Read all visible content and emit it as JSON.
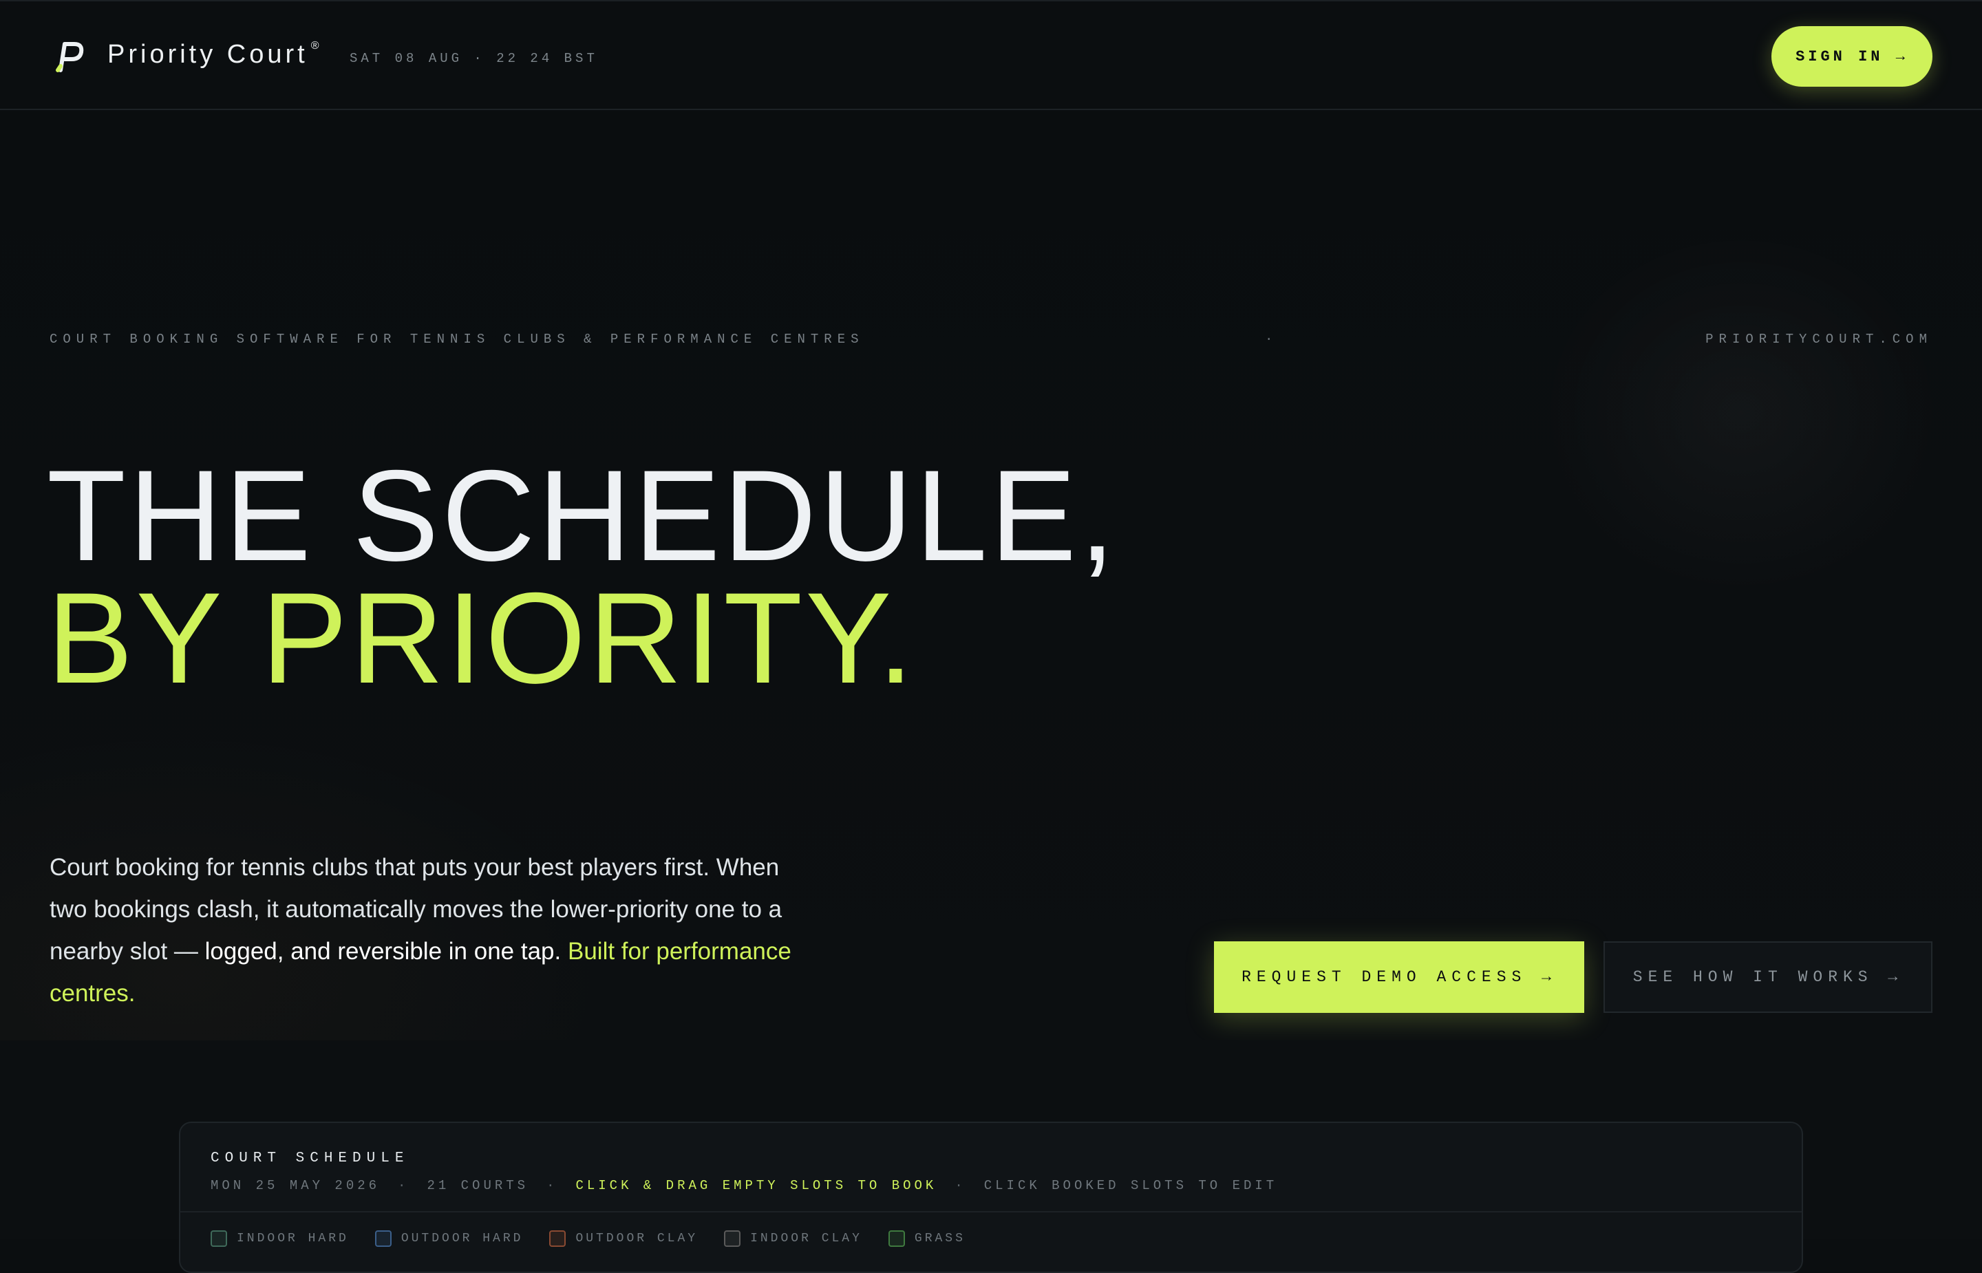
{
  "header": {
    "brand": "Priority Court",
    "brand_mark": "®",
    "datetime": "SAT 08 AUG · 22 24 BST",
    "signin_label": "SIGN IN →"
  },
  "hero": {
    "eyebrow_left": "COURT BOOKING SOFTWARE FOR TENNIS CLUBS & PERFORMANCE CENTRES",
    "eyebrow_dot": "·",
    "eyebrow_right": "PRIORITYCOURT.COM",
    "headline_line1": "THE SCHEDULE,",
    "headline_line2": "BY PRIORITY.",
    "lede_part1": "Court booking for tennis clubs that puts your best players first. When two bookings clash, it automatically moves the lower-priority one to a nearby slot — ",
    "lede_strong": "logged, and reversible in one tap.",
    "lede_accent": "Built for performance centres.",
    "cta_primary": "REQUEST DEMO ACCESS →",
    "cta_secondary": "SEE HOW IT WORKS →"
  },
  "schedule": {
    "title": "COURT SCHEDULE",
    "date": "MON 25 MAY 2026",
    "courts": "21 COURTS",
    "hint_primary": "CLICK & DRAG EMPTY SLOTS TO BOOK",
    "hint_secondary": "CLICK BOOKED SLOTS TO EDIT",
    "separator": "·",
    "legend": [
      {
        "label": "INDOOR HARD",
        "color": "#3f6a5a"
      },
      {
        "label": "OUTDOOR HARD",
        "color": "#3b5f8a"
      },
      {
        "label": "OUTDOOR CLAY",
        "color": "#8a4a32"
      },
      {
        "label": "INDOOR CLAY",
        "color": "#5a5a5a"
      },
      {
        "label": "GRASS",
        "color": "#3f7a3f"
      }
    ]
  },
  "colors": {
    "accent": "#cff25a",
    "background": "#0b0e10"
  },
  "icons": {
    "logo": "priority-court-logo-icon"
  }
}
